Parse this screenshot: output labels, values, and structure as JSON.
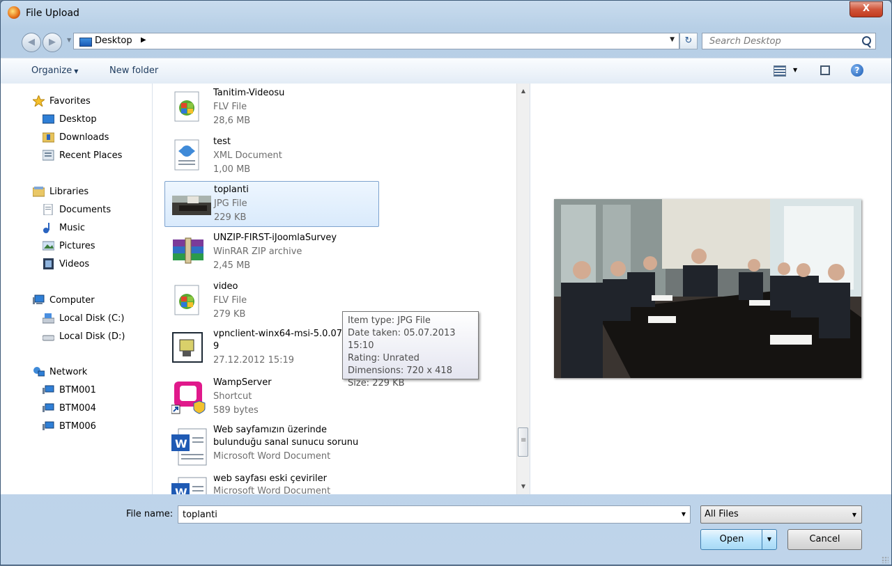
{
  "window": {
    "title": "File Upload",
    "close_label": "X"
  },
  "nav": {
    "location": "Desktop",
    "search_placeholder": "Search Desktop"
  },
  "toolbar": {
    "organize": "Organize",
    "new_folder": "New folder"
  },
  "sidebar": {
    "favorites": {
      "label": "Favorites",
      "items": [
        "Desktop",
        "Downloads",
        "Recent Places"
      ]
    },
    "libraries": {
      "label": "Libraries",
      "items": [
        "Documents",
        "Music",
        "Pictures",
        "Videos"
      ]
    },
    "computer": {
      "label": "Computer",
      "items": [
        "Local Disk (C:)",
        "Local Disk (D:)"
      ]
    },
    "network": {
      "label": "Network",
      "items": [
        "BTM001",
        "BTM004",
        "BTM006"
      ]
    }
  },
  "files": [
    {
      "name": "Tanitim-Videosu",
      "type": "FLV File",
      "detail": "28,6 MB",
      "icon": "flv-file-icon"
    },
    {
      "name": "test",
      "type": "XML Document",
      "detail": "1,00 MB",
      "icon": "xml-file-icon"
    },
    {
      "name": "toplanti",
      "type": "JPG File",
      "detail": "229 KB",
      "icon": "jpg-thumbnail"
    },
    {
      "name": "UNZIP-FIRST-iJoomlaSurvey",
      "type": "WinRAR ZIP archive",
      "detail": "2,45 MB",
      "icon": "winrar-archive-icon"
    },
    {
      "name": "video",
      "type": "FLV File",
      "detail": "279 KB",
      "icon": "flv-file-icon"
    },
    {
      "name": "vpnclient-winx64-msi-5.0.07.0290-k\n9",
      "type": "",
      "detail": "27.12.2012 15:19",
      "icon": "installer-icon"
    },
    {
      "name": "WampServer",
      "type": "Shortcut",
      "detail": "589 bytes",
      "icon": "wampserver-shortcut-icon"
    },
    {
      "name": "Web sayfamızın üzerinde\nbulunduğu sanal sunucu sorunu",
      "type": "Microsoft Word Document",
      "detail": "",
      "icon": "word-document-icon"
    },
    {
      "name": "web sayfası eski çeviriler",
      "type": "Microsoft Word Document",
      "detail": "",
      "icon": "word-document-icon"
    }
  ],
  "tooltip": [
    "Item type: JPG File",
    "Date taken: 05.07.2013 15:10",
    "Rating: Unrated",
    "Dimensions: 720 x 418",
    "Size: 229 KB"
  ],
  "bottom": {
    "file_name_label": "File name:",
    "file_name_value": "toplanti",
    "filter": "All Files",
    "open": "Open",
    "cancel": "Cancel"
  }
}
